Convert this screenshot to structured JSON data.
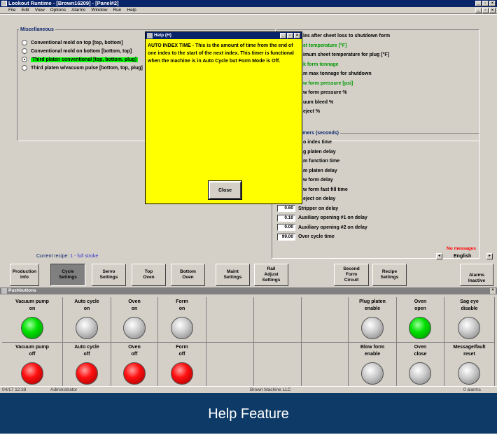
{
  "window": {
    "title": "Lookout Runtime - [Brown16209] - [Panel#2]",
    "menu": [
      "File",
      "Edit",
      "View",
      "Options",
      "Alarms",
      "Window",
      "Run",
      "Help"
    ]
  },
  "misc": {
    "title": "Miscellaneous",
    "options": [
      {
        "label": "Conventional mold on top [top, bottom]",
        "selected": false
      },
      {
        "label": "Conventional mold on bottom [bottom, top]",
        "selected": false
      },
      {
        "label": "Third platen conventional [top, bottom, plug]",
        "selected": true
      },
      {
        "label": "Third platen w/vacuum pulse [bottom, top, plug]",
        "selected": false
      }
    ]
  },
  "right_params": [
    {
      "label": "…les after sheet loss to shutdown form",
      "green": false
    },
    {
      "label": "…et temperature [°F]",
      "green": true
    },
    {
      "label": "…imum sheet temperature for plug [°F]",
      "green": false
    },
    {
      "label": "…k form tonnage",
      "green": true
    },
    {
      "label": "…m max tonnage for shutdown",
      "green": false
    },
    {
      "label": "…w form pressure [psi]",
      "green": true
    },
    {
      "label": "…w form pressure %",
      "green": false
    },
    {
      "label": "…uum bleed %",
      "green": false
    },
    {
      "label": "…eject %",
      "green": false
    }
  ],
  "timers": {
    "title": "…timers (seconds)",
    "rows": [
      {
        "value": "",
        "label": "…o index time"
      },
      {
        "value": "",
        "label": "…g platen delay"
      },
      {
        "value": "",
        "label": "…m function time"
      },
      {
        "value": "",
        "label": "…m platen delay"
      },
      {
        "value": "",
        "label": "…w form delay"
      },
      {
        "value": "",
        "label": "…w form fast fill time"
      },
      {
        "value": "",
        "label": "…eject on delay"
      },
      {
        "value": "0.60",
        "label": "Stripper on delay"
      },
      {
        "value": "0.10",
        "label": "Auxiliary opening #1 on delay"
      },
      {
        "value": "0.00",
        "label": "Auxiliary opening #2 on delay"
      },
      {
        "value": "99.00",
        "label": "Over cycle time"
      }
    ]
  },
  "recipe": {
    "prefix": "Current recipe:",
    "value": "1 - full stroke"
  },
  "messages": "No messages",
  "language": "English",
  "nav_buttons": [
    {
      "label": "Production\nInfo",
      "active": false
    },
    {
      "label": "Cycle\nSettings",
      "active": true
    },
    {
      "label": "Servo\nSettings",
      "active": false
    },
    {
      "label": "Top\nOven",
      "active": false
    },
    {
      "label": "Bottom\nOven",
      "active": false
    },
    {
      "label": "Maint\nSettings",
      "active": false
    },
    {
      "label": "Rail\nAdjust\nSettings",
      "active": false
    },
    {
      "label": "Second\nForm\nCircuit",
      "active": false
    },
    {
      "label": "Recipe\nSettings",
      "active": false
    },
    {
      "label": "Alarms\nInactive",
      "active": false
    }
  ],
  "help": {
    "title": "Help (H)",
    "text": "AUTO INDEX TIME - This is the amount of time from the end of one index to the start of the next index. This timer is functional when the machine is in Auto Cycle but Form Mode is Off.",
    "close": "Close"
  },
  "pushbuttons": {
    "title": "Pushbuttons",
    "top_row": [
      {
        "label": "Vacuum pump\non",
        "lamp": "green"
      },
      {
        "label": "Auto cycle\non",
        "lamp": "gray"
      },
      {
        "label": "Oven\non",
        "lamp": "gray"
      },
      {
        "label": "Form\non",
        "lamp": "gray"
      },
      {
        "label": "",
        "lamp": ""
      },
      {
        "label": "",
        "lamp": ""
      },
      {
        "label": "",
        "lamp": ""
      },
      {
        "label": "Plug platen\nenable",
        "lamp": "gray"
      },
      {
        "label": "Oven\nopen",
        "lamp": "green"
      },
      {
        "label": "Sag eye\ndisable",
        "lamp": "gray"
      }
    ],
    "bottom_row": [
      {
        "label": "Vacuum pump\noff",
        "lamp": "red"
      },
      {
        "label": "Auto cycle\noff",
        "lamp": "red"
      },
      {
        "label": "Oven\noff",
        "lamp": "red"
      },
      {
        "label": "Form\noff",
        "lamp": "red"
      },
      {
        "label": "",
        "lamp": ""
      },
      {
        "label": "",
        "lamp": ""
      },
      {
        "label": "",
        "lamp": ""
      },
      {
        "label": "Blow form\nenable",
        "lamp": "gray"
      },
      {
        "label": "Oven\nclose",
        "lamp": "gray"
      },
      {
        "label": "Message/fault\nreset",
        "lamp": "gray"
      }
    ]
  },
  "status": {
    "time": "04/17 12:38",
    "user": "Administrator",
    "company": "Brown Machine LLC",
    "alarms": "0 alarms"
  },
  "caption": "Help Feature"
}
